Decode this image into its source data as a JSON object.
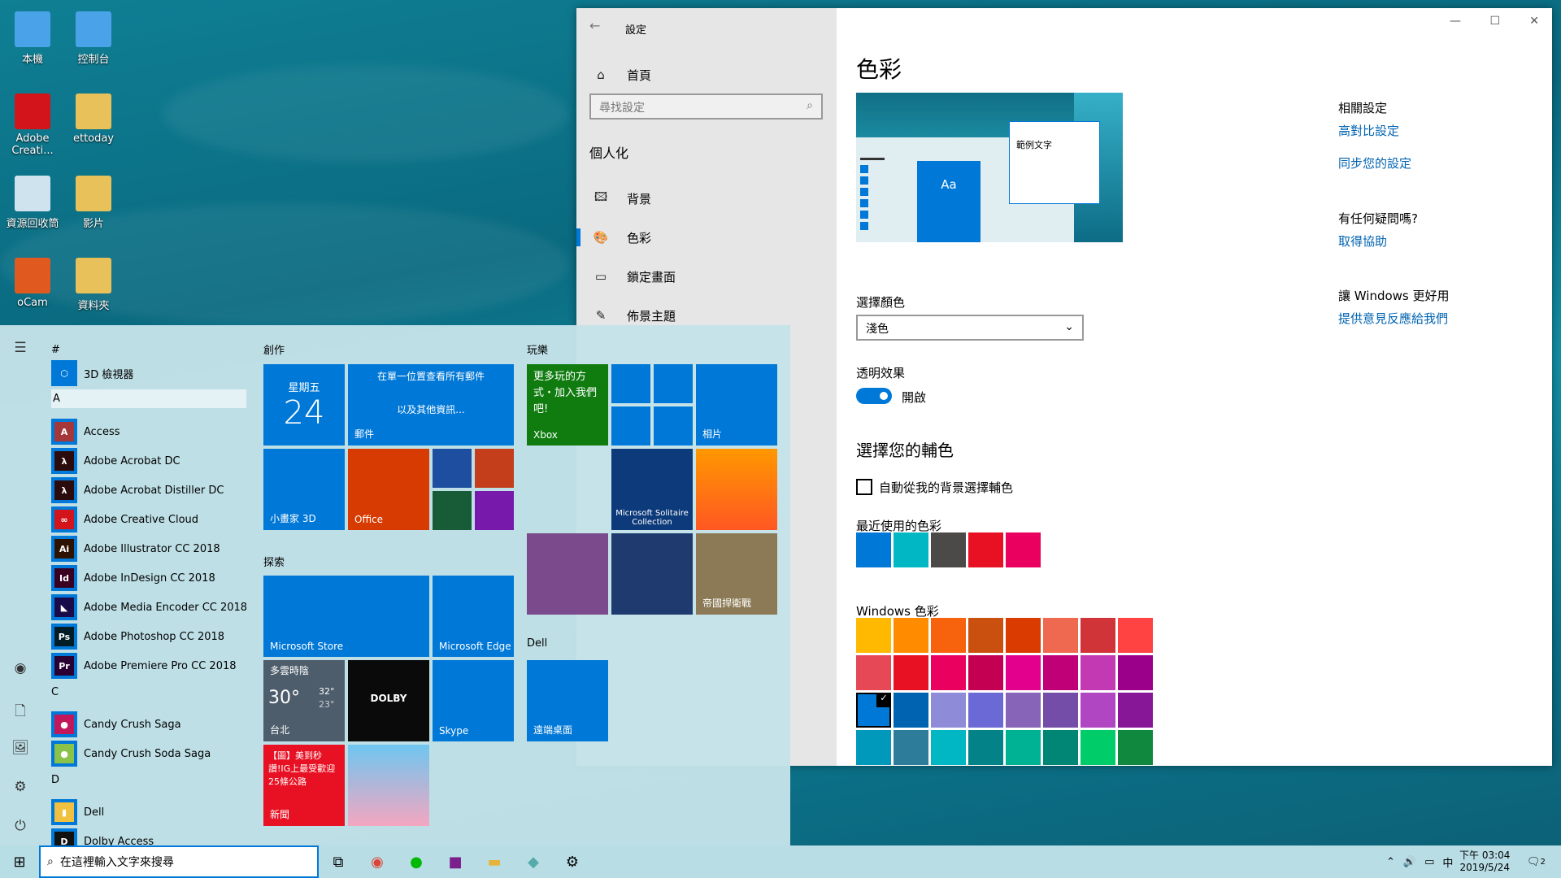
{
  "desktop": {
    "icons": [
      {
        "label": "本機",
        "icon": "computer-icon"
      },
      {
        "label": "控制台",
        "icon": "control-panel-icon"
      },
      {
        "label": "Adobe Creati...",
        "icon": "creative-cloud-icon"
      },
      {
        "label": "ettoday",
        "icon": "user-folder-icon"
      },
      {
        "label": "資源回收筒",
        "icon": "recycle-bin-icon"
      },
      {
        "label": "影片",
        "icon": "videos-folder-icon"
      },
      {
        "label": "oCam",
        "icon": "ocam-icon"
      },
      {
        "label": "資料夾",
        "icon": "folder-icon"
      }
    ]
  },
  "settings": {
    "title": "設定",
    "nav": {
      "home": "首頁",
      "search_placeholder": "尋找設定",
      "section": "個人化",
      "items": [
        {
          "label": "背景",
          "icon": "picture-icon"
        },
        {
          "label": "色彩",
          "icon": "palette-icon",
          "active": true
        },
        {
          "label": "鎖定畫面",
          "icon": "lock-screen-icon"
        },
        {
          "label": "佈景主題",
          "icon": "theme-icon"
        }
      ]
    },
    "content": {
      "title": "色彩",
      "preview_text": "範例文字",
      "preview_tile": "Aa",
      "choose_color_label": "選擇顏色",
      "choose_color_value": "淺色",
      "transparency_label": "透明效果",
      "transparency_state": "開啟",
      "transparency_on": true,
      "accent_heading": "選擇您的輔色",
      "auto_accent_label": "自動從我的背景選擇輔色",
      "auto_accent_checked": false,
      "recent_label": "最近使用的色彩",
      "recent_colors": [
        "#0078d7",
        "#00b7c3",
        "#4c4a48",
        "#e81123",
        "#ea005e"
      ],
      "windows_label": "Windows 色彩",
      "windows_colors": [
        [
          "#ffb900",
          "#ff8c00",
          "#f7630c",
          "#ca5010",
          "#da3b01",
          "#ef6950",
          "#d13438",
          "#ff4343"
        ],
        [
          "#e74856",
          "#e81123",
          "#ea005e",
          "#c30052",
          "#e3008c",
          "#bf0077",
          "#c239b3",
          "#9a0089"
        ],
        [
          "#0078d7",
          "#0063b1",
          "#8e8cd8",
          "#6b69d6",
          "#8764b8",
          "#744da9",
          "#b146c2",
          "#881798"
        ],
        [
          "#0099bc",
          "#2d7d9a",
          "#00b7c3",
          "#038387",
          "#00b294",
          "#018574",
          "#00cc6a",
          "#10893e"
        ]
      ],
      "selected_color": "#0078d7"
    },
    "related": {
      "heading": "相關設定",
      "links": [
        "高對比設定",
        "同步您的設定"
      ],
      "help_heading": "有任何疑問嗎?",
      "help_link": "取得協助",
      "feedback_heading": "讓 Windows 更好用",
      "feedback_link": "提供意見反應給我們"
    }
  },
  "start": {
    "apps": [
      {
        "type": "letter",
        "label": "#"
      },
      {
        "type": "app",
        "label": "3D 檢視器",
        "icon": "⬡"
      },
      {
        "type": "letter",
        "label": "A"
      },
      {
        "type": "app",
        "label": "Access",
        "icon": "A",
        "color": "#a4373a"
      },
      {
        "type": "app",
        "label": "Adobe Acrobat DC",
        "icon": "λ",
        "color": "#2b0b0b"
      },
      {
        "type": "app",
        "label": "Adobe Acrobat Distiller DC",
        "icon": "λ",
        "color": "#2b0b0b"
      },
      {
        "type": "app",
        "label": "Adobe Creative Cloud",
        "icon": "∞",
        "color": "#d4141b"
      },
      {
        "type": "app",
        "label": "Adobe Illustrator CC 2018",
        "icon": "Ai",
        "color": "#2e1200"
      },
      {
        "type": "app",
        "label": "Adobe InDesign CC 2018",
        "icon": "Id",
        "color": "#3a0022"
      },
      {
        "type": "app",
        "label": "Adobe Media Encoder CC 2018",
        "icon": "◣",
        "color": "#1b0a4a"
      },
      {
        "type": "app",
        "label": "Adobe Photoshop CC 2018",
        "icon": "Ps",
        "color": "#001d26"
      },
      {
        "type": "app",
        "label": "Adobe Premiere Pro CC 2018",
        "icon": "Pr",
        "color": "#2a0033"
      },
      {
        "type": "letter",
        "label": "C"
      },
      {
        "type": "app",
        "label": "Candy Crush Saga",
        "icon": "●",
        "color": "#c2185b"
      },
      {
        "type": "app",
        "label": "Candy Crush Soda Saga",
        "icon": "●",
        "color": "#8bc34a"
      },
      {
        "type": "letter",
        "label": "D"
      },
      {
        "type": "app",
        "label": "Dell",
        "icon": "▮",
        "color": "#f0c040"
      },
      {
        "type": "app",
        "label": "Dolby Access",
        "icon": "D",
        "color": "#111"
      }
    ],
    "groups": {
      "create": "創作",
      "explore": "探索",
      "play": "玩樂",
      "dell": "Dell"
    },
    "tiles": {
      "calendar": {
        "day": "星期五",
        "date": "24"
      },
      "mail": {
        "headline": "在單一位置查看所有郵件",
        "sub": "以及其他資訊...",
        "label": "郵件"
      },
      "paint3d": "小畫家 3D",
      "office": "Office",
      "xbox": {
        "text": "更多玩的方式・加入我們吧!",
        "label": "Xbox"
      },
      "photos": "相片",
      "solitaire": "Microsoft Solitaire Collection",
      "empire": "帝國捍衛戰",
      "store": "Microsoft Store",
      "edge": "Microsoft Edge",
      "weather": {
        "condition": "多雲時陰",
        "temp": "30°",
        "high": "32°",
        "low": "23°",
        "city": "台北"
      },
      "skype": "Skype",
      "remote": "遠端桌面",
      "news": {
        "text": "【圖】美到秒讚!IG上最受歡迎25條公路",
        "label": "新聞"
      }
    }
  },
  "taskbar": {
    "search_placeholder": "在這裡輸入文字來搜尋",
    "time": "下午 03:04",
    "date": "2019/5/24",
    "ime": "中",
    "notifications": "2"
  }
}
